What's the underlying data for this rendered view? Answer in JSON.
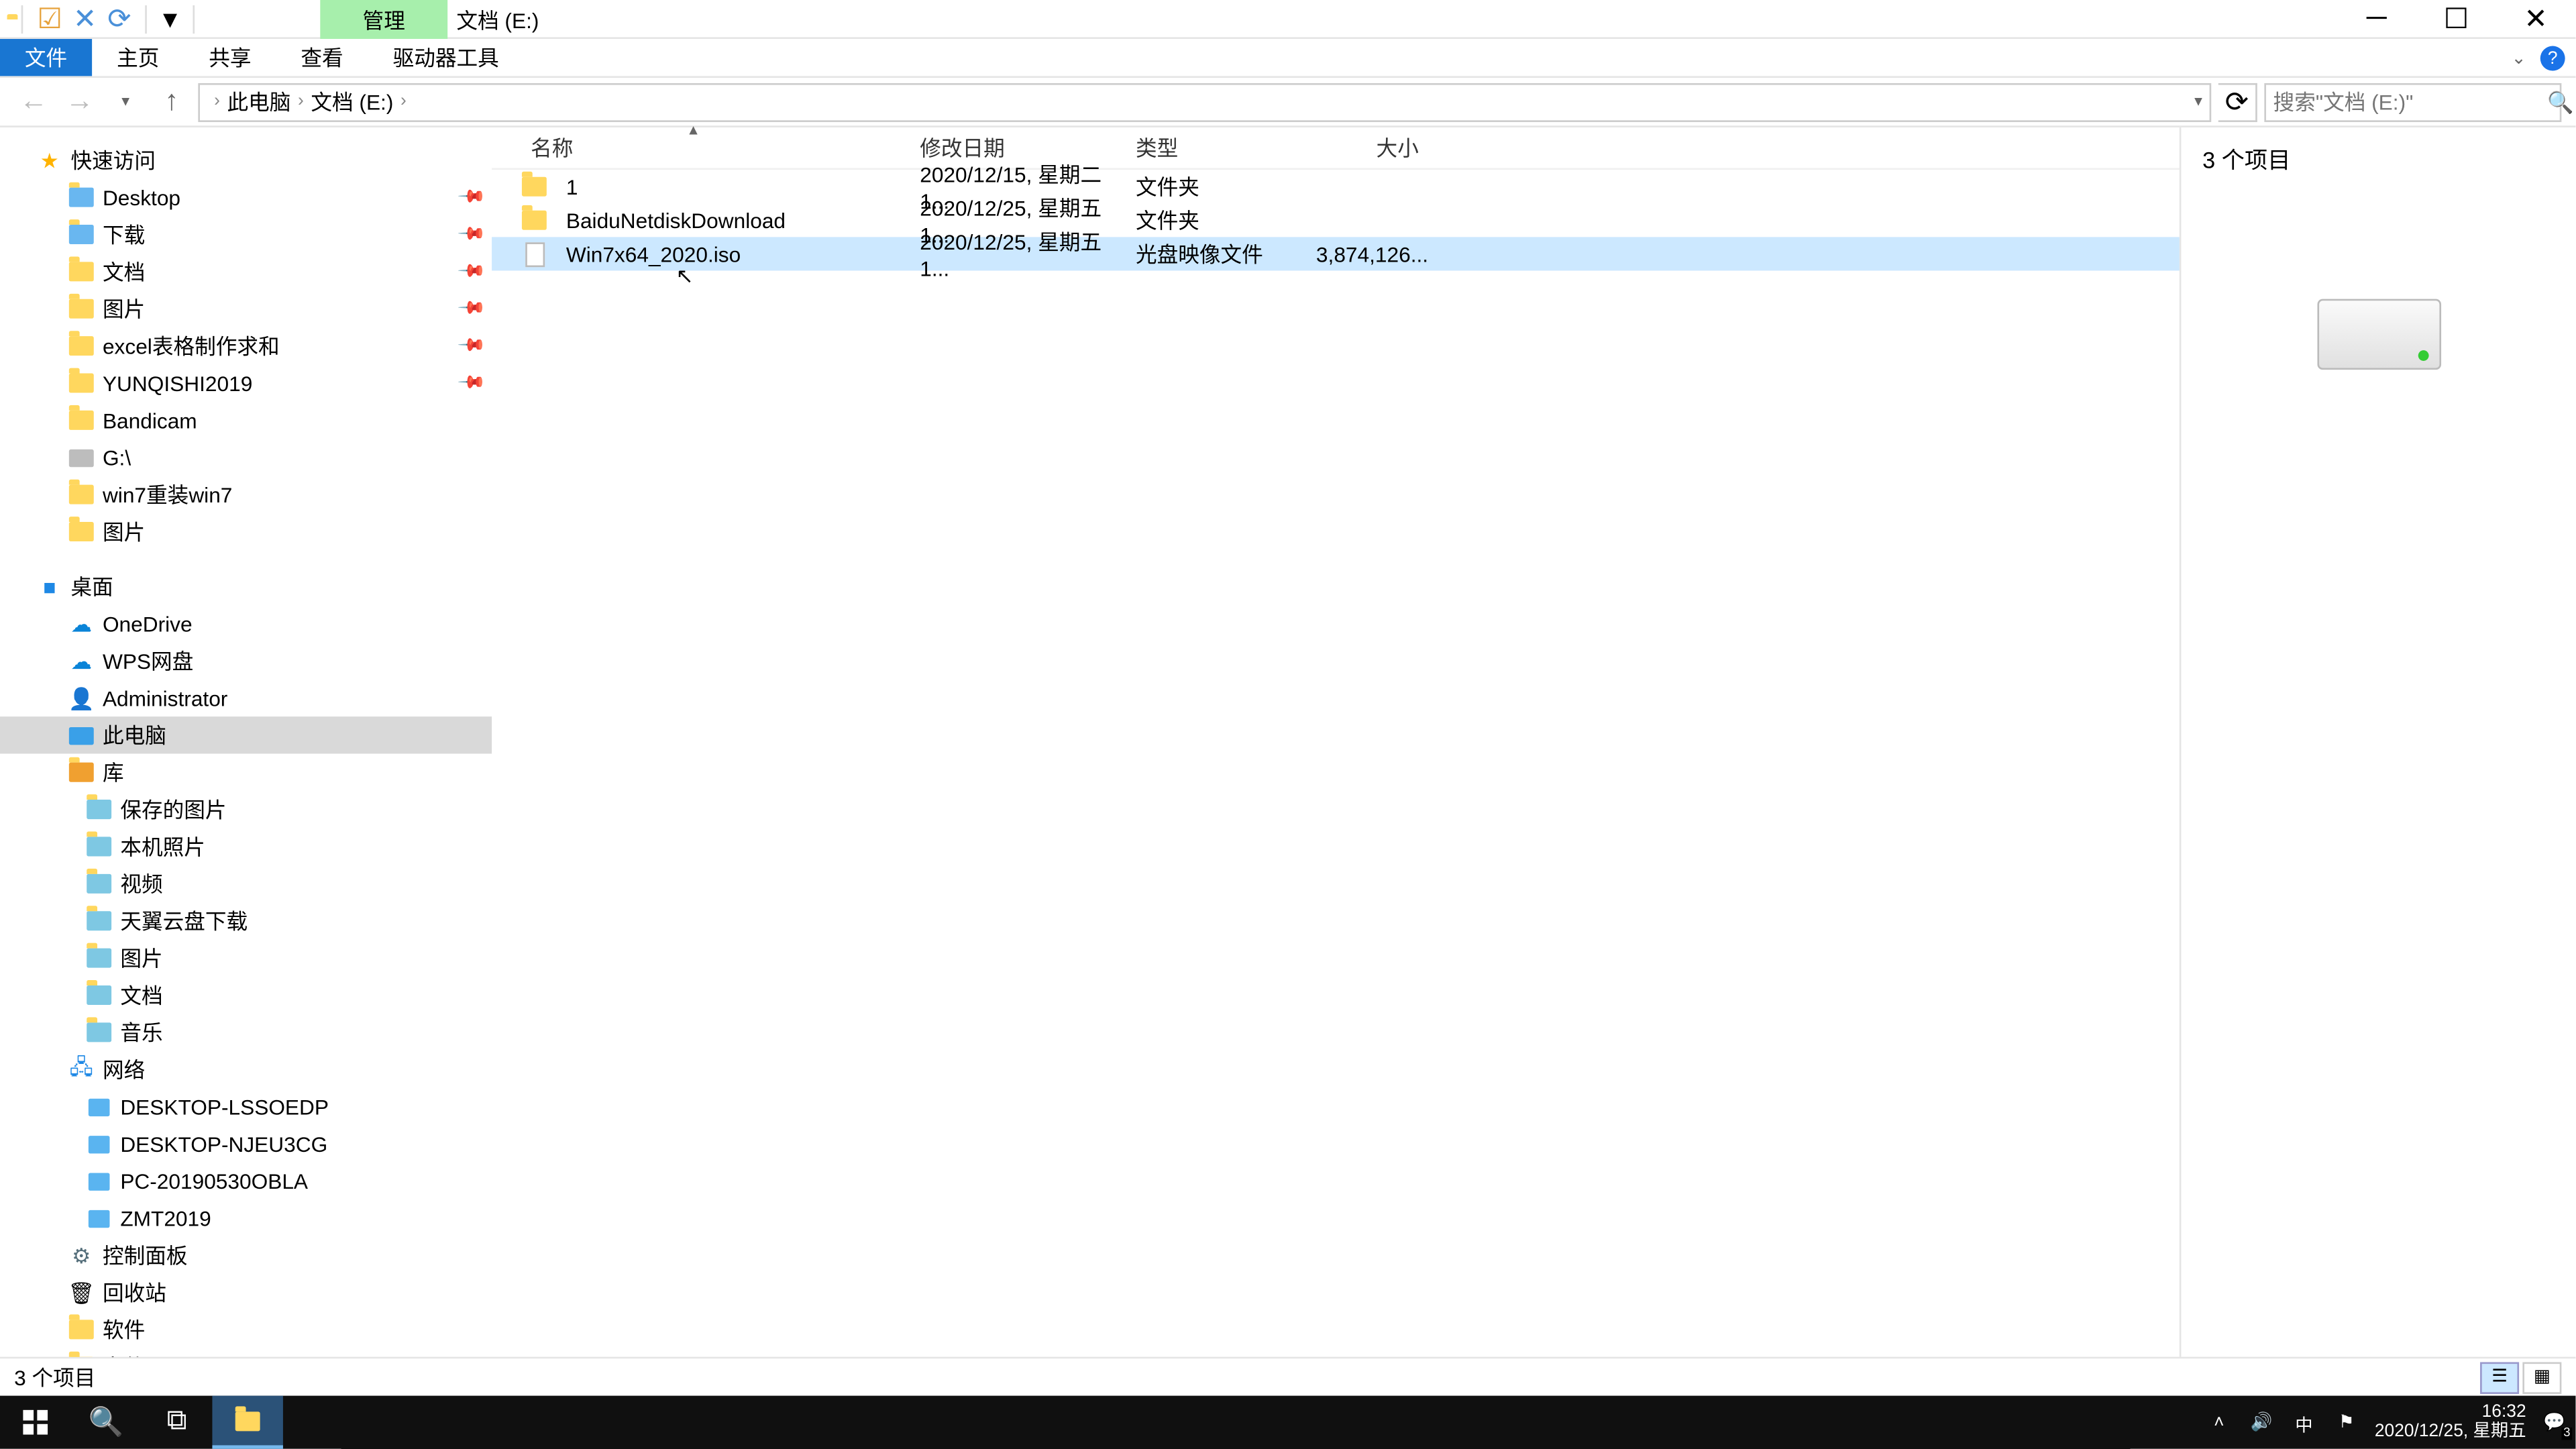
{
  "titlebar": {
    "context_tab": "管理",
    "title": "文档 (E:)"
  },
  "ribbon": {
    "file": "文件",
    "home": "主页",
    "share": "共享",
    "view": "查看",
    "drive_tools": "驱动器工具"
  },
  "nav": {
    "crumbs": [
      "此电脑",
      "文档 (E:)"
    ],
    "search_placeholder": "搜索\"文档 (E:)\""
  },
  "sidebar": {
    "quick_access": "快速访问",
    "pinned": [
      {
        "label": "Desktop"
      },
      {
        "label": "下载"
      },
      {
        "label": "文档"
      },
      {
        "label": "图片"
      },
      {
        "label": "excel表格制作求和"
      },
      {
        "label": "YUNQISHI2019"
      },
      {
        "label": "Bandicam"
      },
      {
        "label": "G:\\"
      },
      {
        "label": "win7重装win7"
      },
      {
        "label": "图片"
      }
    ],
    "desktop": "桌面",
    "desktop_children": [
      {
        "label": "OneDrive",
        "kind": "cloud"
      },
      {
        "label": "WPS网盘",
        "kind": "cloud"
      },
      {
        "label": "Administrator",
        "kind": "user"
      },
      {
        "label": "此电脑",
        "kind": "pc",
        "selected": true
      },
      {
        "label": "库",
        "kind": "lib"
      }
    ],
    "libraries": [
      {
        "label": "保存的图片"
      },
      {
        "label": "本机照片"
      },
      {
        "label": "视频"
      },
      {
        "label": "天翼云盘下载"
      },
      {
        "label": "图片"
      },
      {
        "label": "文档"
      },
      {
        "label": "音乐"
      }
    ],
    "network": "网络",
    "network_nodes": [
      {
        "label": "DESKTOP-LSSOEDP"
      },
      {
        "label": "DESKTOP-NJEU3CG"
      },
      {
        "label": "PC-20190530OBLA"
      },
      {
        "label": "ZMT2019"
      }
    ],
    "control_panel": "控制面板",
    "recycle": "回收站",
    "software": "软件",
    "files": "文件"
  },
  "columns": {
    "name": "名称",
    "date": "修改日期",
    "type": "类型",
    "size": "大小"
  },
  "rows": [
    {
      "name": "1",
      "date": "2020/12/15, 星期二 1...",
      "type": "文件夹",
      "size": "",
      "kind": "folder"
    },
    {
      "name": "BaiduNetdiskDownload",
      "date": "2020/12/25, 星期五 1...",
      "type": "文件夹",
      "size": "",
      "kind": "folder"
    },
    {
      "name": "Win7x64_2020.iso",
      "date": "2020/12/25, 星期五 1...",
      "type": "光盘映像文件",
      "size": "3,874,126...",
      "kind": "file",
      "selected": true
    }
  ],
  "preview": {
    "count_label": "3 个项目"
  },
  "status": {
    "text": "3 个项目"
  },
  "taskbar": {
    "time": "16:32",
    "date": "2020/12/25, 星期五",
    "ime": "中",
    "notif_badge": "3"
  }
}
